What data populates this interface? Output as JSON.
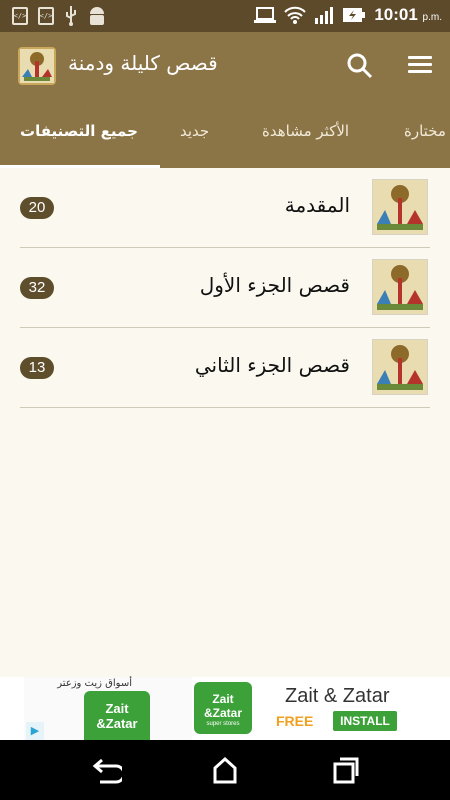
{
  "status_bar": {
    "time": "10:01",
    "ampm": "p.m.",
    "icons": [
      "dev-icon",
      "dev-icon",
      "usb-icon",
      "android-icon",
      "laptop-icon",
      "wifi-icon",
      "signal-icon",
      "battery-icon"
    ]
  },
  "app_bar": {
    "title": "قصص كليلة ودمنة",
    "icons": [
      "app-logo-icon",
      "search-icon",
      "menu-icon"
    ]
  },
  "tabs": [
    {
      "label": "مختارة",
      "active": false
    },
    {
      "label": "الأكثر مشاهدة",
      "active": false
    },
    {
      "label": "جديد",
      "active": false
    },
    {
      "label": "جميع التصنيفات",
      "active": true
    }
  ],
  "categories": [
    {
      "title": "المقدمة",
      "count": "20"
    },
    {
      "title": "قصص الجزء الأول",
      "count": "32"
    },
    {
      "title": "قصص الجزء الثاني",
      "count": "13"
    }
  ],
  "ad": {
    "small_brand": "أسواق زيت وزعتر",
    "logo_text": "Zait\n&Zatar",
    "logo_sub": "super stores",
    "name": "Zait & Zatar",
    "free": "FREE",
    "install": "INSTALL"
  },
  "colors": {
    "primary": "#8b7446",
    "status_bar": "#5c4a2a",
    "badge": "#5e4e2c",
    "background": "#faf8ef",
    "ad_green": "#3da13a"
  },
  "nav_bar": {
    "icons": [
      "back-icon",
      "home-icon",
      "recents-icon"
    ]
  }
}
